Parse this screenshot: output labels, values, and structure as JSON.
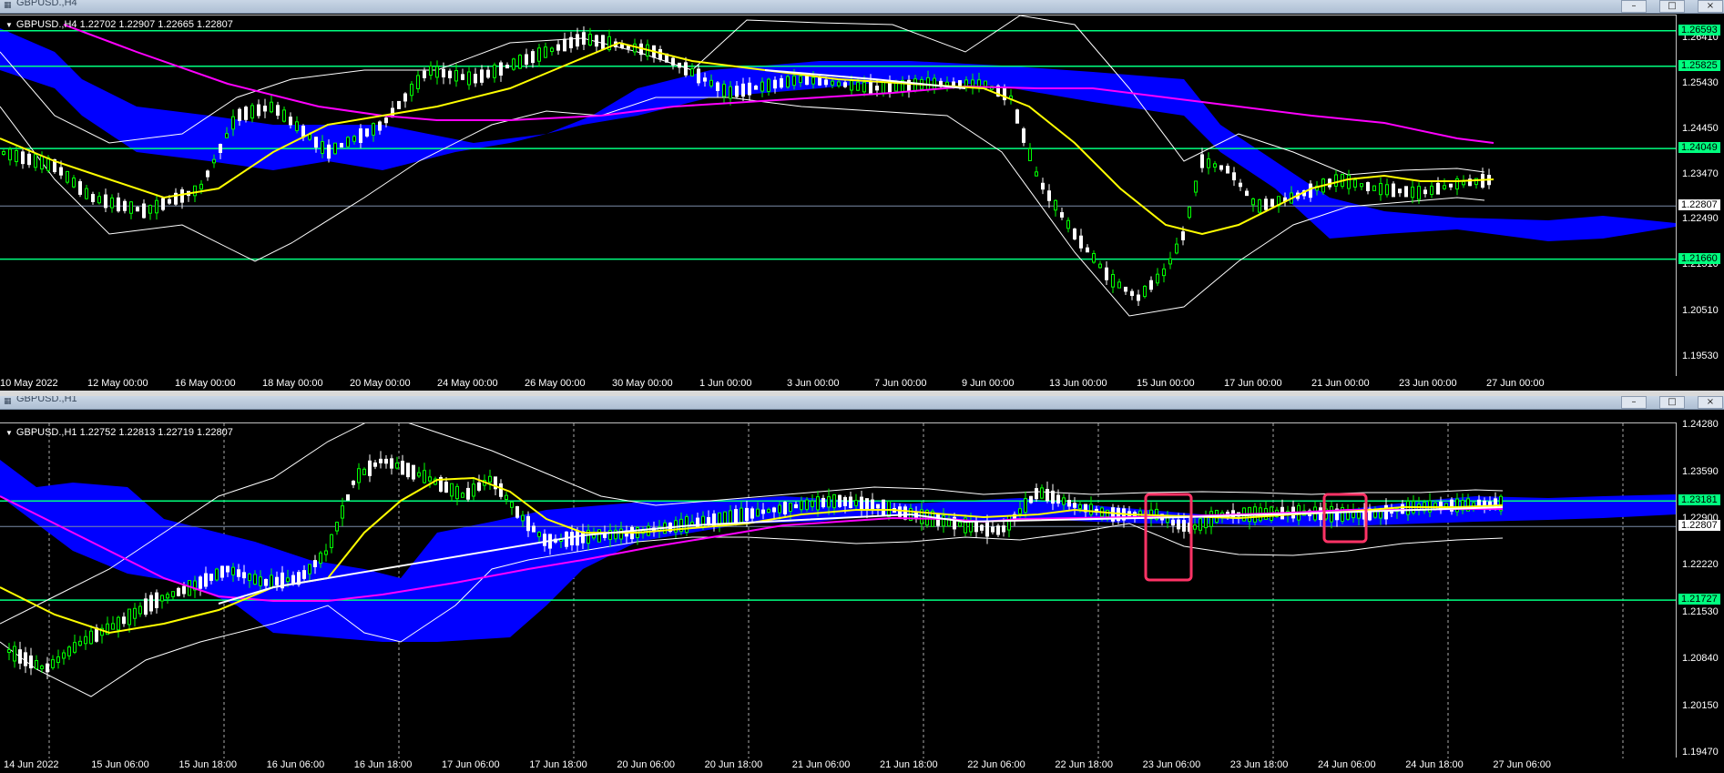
{
  "windows": [
    {
      "title": "GBPUSD.,H4",
      "symbol_line": "GBPUSD.,H4  1.22702 1.22907 1.22665 1.22807",
      "price_ticks": [
        "1.26410",
        "1.25430",
        "1.24450",
        "1.23470",
        "1.22490",
        "1.21510",
        "1.20510",
        "1.19530"
      ],
      "hlines": [
        {
          "price": "1.26593",
          "color": "#00ff7f"
        },
        {
          "price": "1.25825",
          "color": "#00ff7f"
        },
        {
          "price": "1.24049",
          "color": "#00ff7f"
        },
        {
          "price": "1.22807",
          "color": "#ffffff"
        },
        {
          "price": "1.21660",
          "color": "#00ff7f"
        }
      ],
      "time_ticks": [
        "10 May 2022",
        "12 May 00:00",
        "16 May 00:00",
        "18 May 00:00",
        "20 May 00:00",
        "24 May 00:00",
        "26 May 00:00",
        "30 May 00:00",
        "1 Jun 00:00",
        "3 Jun 00:00",
        "7 Jun 00:00",
        "9 Jun 00:00",
        "13 Jun 00:00",
        "15 Jun 00:00",
        "17 Jun 00:00",
        "21 Jun 00:00",
        "23 Jun 00:00",
        "27 Jun 00:00"
      ]
    },
    {
      "title": "GBPUSD.,H1",
      "symbol_line": "GBPUSD.,H1  1.22752 1.22813 1.22719 1.22807",
      "price_ticks": [
        "1.24280",
        "1.23590",
        "1.22900",
        "1.22220",
        "1.21530",
        "1.20840",
        "1.20150",
        "1.19470"
      ],
      "hlines": [
        {
          "price": "1.23181",
          "color": "#00ff7f"
        },
        {
          "price": "1.22807",
          "color": "#ffffff"
        },
        {
          "price": "1.21727",
          "color": "#00ff7f"
        }
      ],
      "time_ticks": [
        "14 Jun 2022",
        "15 Jun 06:00",
        "15 Jun 18:00",
        "16 Jun 06:00",
        "16 Jun 18:00",
        "17 Jun 06:00",
        "17 Jun 18:00",
        "20 Jun 06:00",
        "20 Jun 18:00",
        "21 Jun 06:00",
        "21 Jun 18:00",
        "22 Jun 06:00",
        "22 Jun 18:00",
        "23 Jun 06:00",
        "23 Jun 18:00",
        "24 Jun 06:00",
        "24 Jun 18:00",
        "27 Jun 06:00"
      ]
    }
  ],
  "colors": {
    "ichimoku_cloud": "#0000ff",
    "ma_fast": "#ffff00",
    "ma_slow": "#ff00ff",
    "bollinger": "#ffffff",
    "candle_up": "#00ff00",
    "candle_down": "#ffffff",
    "highlight_box": "#ff3366"
  }
}
